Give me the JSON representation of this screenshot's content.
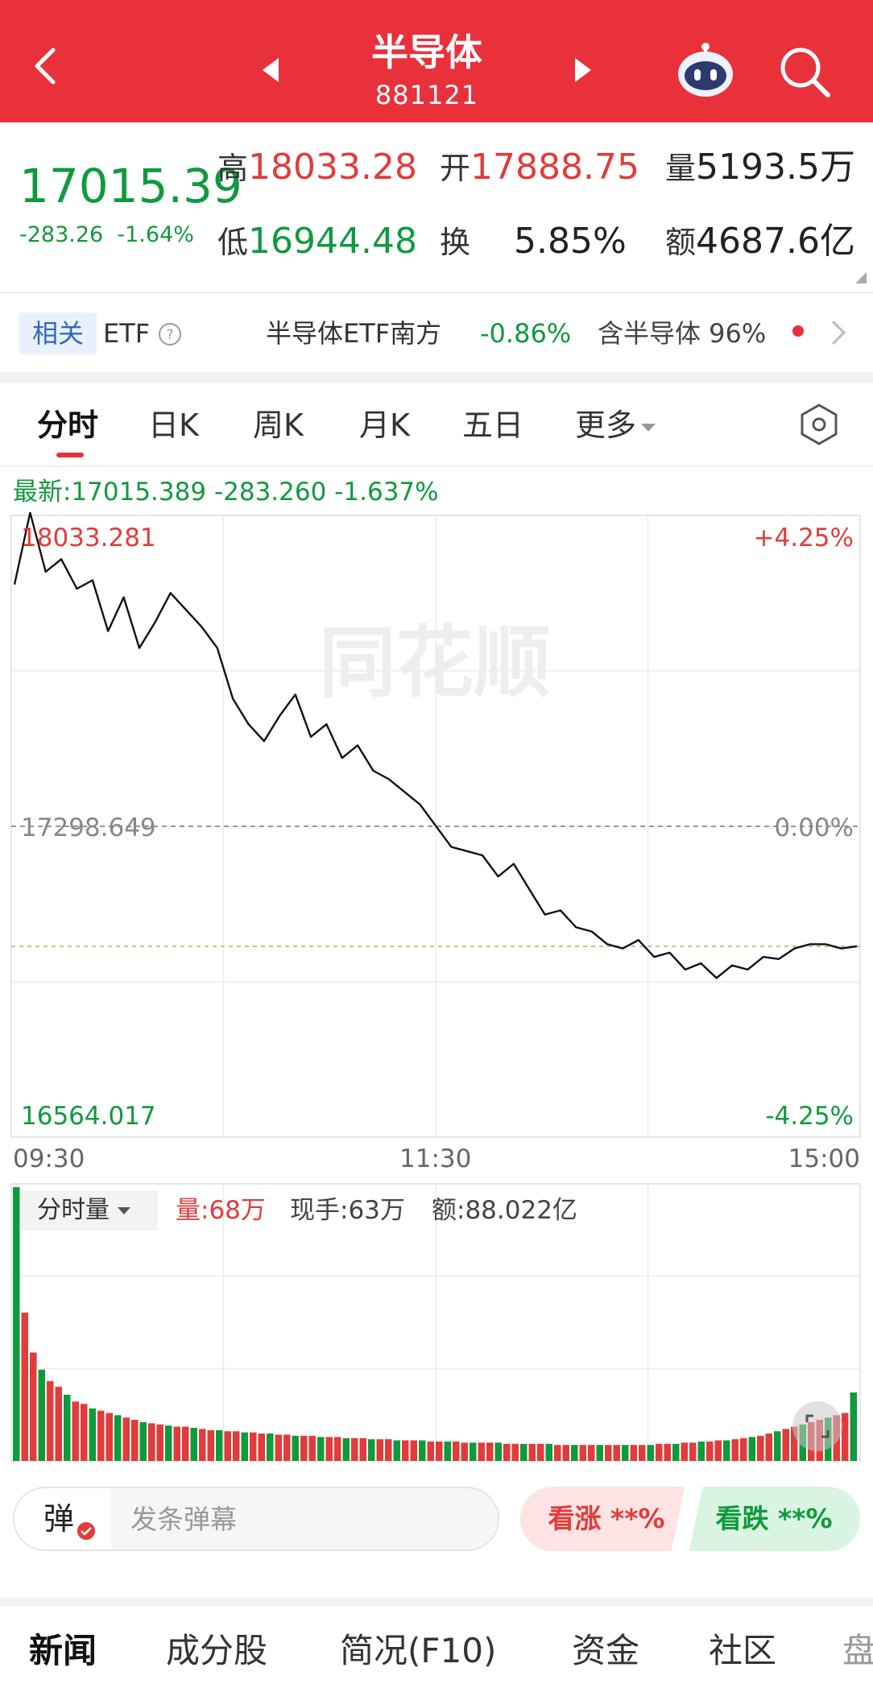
{
  "header": {
    "title": "半导体",
    "code": "881121",
    "bg_color": "#e8313b"
  },
  "quote": {
    "price": "17015.39",
    "change": "-283.26",
    "change_pct": "-1.64%",
    "high_label": "高",
    "high": "18033.28",
    "open_label": "开",
    "open": "17888.75",
    "volume_label": "量",
    "volume": "5193.5万",
    "low_label": "低",
    "low": "16944.48",
    "turnover_label": "换",
    "turnover": "5.85%",
    "amount_label": "额",
    "amount": "4687.6亿"
  },
  "related": {
    "badge": "相关",
    "etf_label": "ETF",
    "etf_name": "半导体ETF南方",
    "etf_pct": "-0.86%",
    "holding_text": "含半导体 96%"
  },
  "tabs": {
    "items": [
      "分时",
      "日K",
      "周K",
      "月K",
      "五日"
    ],
    "more": "更多",
    "active": 0
  },
  "intraday": {
    "latest_label": "最新:17015.389",
    "latest_change": "-283.260",
    "latest_pct": "-1.637%",
    "y_max": "18033.281",
    "y_mid": "17298.649",
    "y_min": "16564.017",
    "pct_max": "+4.25%",
    "pct_mid": "0.00%",
    "pct_min": "-4.25%",
    "t_start": "09:30",
    "t_mid": "11:30",
    "t_end": "15:00",
    "watermark": "同花顺"
  },
  "chart_data": {
    "type": "line",
    "title": "",
    "xlabel": "",
    "ylabel": "",
    "x_ticks": [
      "09:30",
      "11:30",
      "15:00"
    ],
    "ylim": [
      16564.017,
      18033.281
    ],
    "prev_close": 17298.649,
    "avg_line": 17015.0,
    "grid": true,
    "series": [
      {
        "values": [
          17870,
          18040,
          17900,
          17930,
          17860,
          17880,
          17760,
          17840,
          17720,
          17780,
          17850,
          17810,
          17770,
          17720,
          17600,
          17540,
          17500,
          17560,
          17610,
          17510,
          17540,
          17460,
          17490,
          17430,
          17410,
          17380,
          17350,
          17300,
          17250,
          17240,
          17230,
          17180,
          17210,
          17150,
          17090,
          17100,
          17060,
          17050,
          17020,
          17010,
          17030,
          16990,
          17000,
          16960,
          16975,
          16940,
          16970,
          16960,
          16990,
          16985,
          17010,
          17020,
          17020,
          17010,
          17015
        ]
      }
    ],
    "volume": {
      "label": "分时量",
      "current": "量:68万",
      "current_hand": "现手:63万",
      "amount": "额:88.022亿",
      "bars": [
        240,
        130,
        95,
        80,
        70,
        65,
        58,
        52,
        50,
        46,
        44,
        42,
        40,
        38,
        36,
        34,
        33,
        32,
        31,
        30,
        30,
        29,
        28,
        27,
        27,
        26,
        26,
        25,
        25,
        24,
        24,
        23,
        23,
        22,
        22,
        22,
        21,
        21,
        21,
        20,
        20,
        20,
        19,
        19,
        19,
        18,
        18,
        18,
        18,
        17,
        17,
        17,
        17,
        16,
        16,
        16,
        16,
        16,
        15,
        15,
        15,
        15,
        15,
        15,
        14,
        14,
        14,
        14,
        14,
        14,
        14,
        14,
        14,
        14,
        14,
        14,
        15,
        15,
        15,
        16,
        16,
        17,
        17,
        18,
        18,
        19,
        20,
        21,
        22,
        24,
        26,
        28,
        30,
        32,
        34,
        36,
        38,
        40,
        42,
        60
      ]
    }
  },
  "danmaku": {
    "icon": "弹",
    "placeholder": "发条弹幕",
    "bull": "看涨  **%",
    "bear": "看跌  **%"
  },
  "bottom_tabs": [
    "新闻",
    "成分股",
    "简况(F10)",
    "资金",
    "社区",
    "盘"
  ],
  "colors": {
    "up": "#e23b3b",
    "down": "#0f9a3e",
    "accent": "#e8313b"
  }
}
